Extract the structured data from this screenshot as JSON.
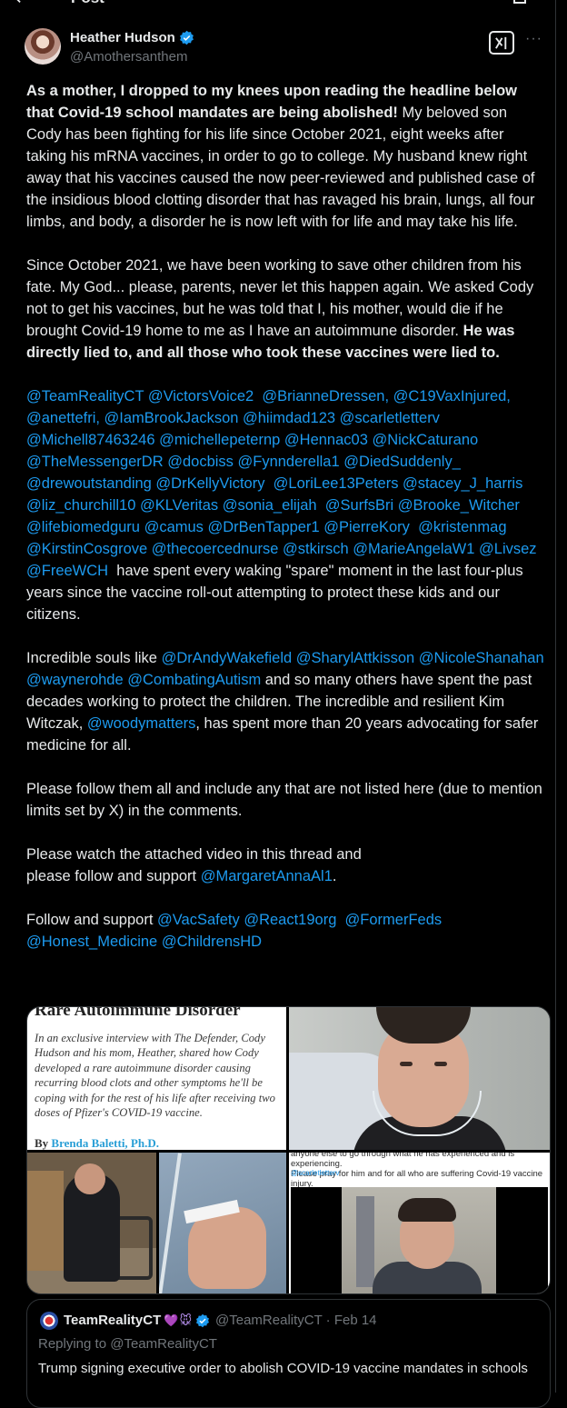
{
  "header": {
    "title": "Post"
  },
  "author": {
    "name": "Heather Hudson",
    "handle": "@Amothersanthem",
    "verified": true
  },
  "actions": {
    "grok_icon": "grok-icon",
    "more_label": "···"
  },
  "body": {
    "p1_bold": "As a mother, I dropped to my knees upon reading the headline below that Covid-19 school mandates are being abolished!",
    "p1_rest": " My beloved son Cody has been fighting for his life since October 2021, eight weeks after taking his mRNA vaccines, in order to go to college. My husband knew right away that his vaccines caused the now peer-reviewed and published case of the insidious blood clotting disorder that has ravaged his brain, lungs, all four limbs, and body, a disorder he is now left with for life and may take his life.",
    "p2_rest": "Since October 2021, we have been working to save other children from his fate. My God... please, parents, never let this happen again. We asked Cody not to get his vaccines, but he was told that I, his mother, would die if he brought Covid-19 home to me as I have an autoimmune disorder. ",
    "p2_bold": "He was directly lied to, and all those who took these vaccines were lied to.",
    "p3_mentions": "@TeamRealityCT @VictorsVoice2  @BrianneDressen, @C19VaxInjured, @anettefri, @IamBrookJackson @hiimdad123 @scarletletterv @Michell87463246 @michellepeternp @Hennac03 @NickCaturano @TheMessengerDR @docbiss @Fynnderella1 @DiedSuddenly_ @drewoutstanding @DrKellyVictory  @LoriLee13Peters @stacey_J_harris @liz_churchill10 @KLVeritas @sonia_elijah  @SurfsBri @Brooke_Witcher @lifebiomedguru @camus @DrBenTapper1 @PierreKory  @kristenmag @KirstinCosgrove @thecoercednurse @stkirsch @MarieAngelaW1 @Livsez @FreeWCH",
    "p3_rest": "  have spent every waking \"spare\" moment in the last four-plus years since the vaccine roll-out attempting to protect these kids and our citizens.",
    "p4_a": "Incredible souls like ",
    "p4_m1": "@DrAndyWakefield @SharylAttkisson @NicoleShanahan @waynerohde @CombatingAutism",
    "p4_b": " and so many others have spent the past decades working to protect the children. The incredible and resilient Kim Witczak, ",
    "p4_m2": "@woodymatters",
    "p4_c": ", has spent more than 20 years advocating for safer medicine for all.",
    "p5": "Please follow them all and include any that are not listed here (due to mention limits set by X) in the comments.",
    "p6_a": "Please watch the attached video in this thread and\nplease follow and support ",
    "p6_m": "@MargaretAnnaAl1",
    "p6_b": ".",
    "p7_a": "Follow and support ",
    "p7_m": "@VacSafety @React19org  @FormerFeds @Honest_Medicine @ChildrensHD"
  },
  "media": {
    "article_title": "Rare Autoimmune Disorder",
    "article_body": "In an exclusive interview with The Defender, Cody Hudson and his mom, Heather, shared how Cody developed a rare autoimmune disorder causing recurring blood clots and other symptoms he'll be coping with for the rest of his life after receiving two doses of Pfizer's COVID-19 vaccine.",
    "article_by_prefix": "By ",
    "article_author": "Brenda Baletti, Ph.D.",
    "caption": "anyone else to go through what he has experienced and is experiencing.\nPlease pray for him and for all who are suffering Covid-19 vaccine injury.",
    "caption_tag": "@scarletletterv"
  },
  "quote": {
    "name": "TeamRealityCT",
    "emoji": "💜🐭",
    "handle_date": "@TeamRealityCT · Feb 14",
    "replying_prefix": "Replying to ",
    "replying_to": "@TeamRealityCT",
    "text": "Trump signing executive order to abolish COVID-19 vaccine mandates in schools"
  },
  "colors": {
    "accent": "#1d9bf0",
    "background": "#000000",
    "text": "#e7e9ea",
    "muted": "#71767b"
  }
}
